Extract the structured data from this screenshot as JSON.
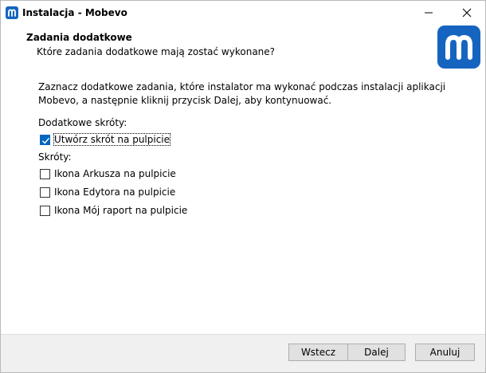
{
  "window": {
    "title": "Instalacja - Mobevo",
    "app_icon": "mobevo-app-icon",
    "minimize_icon": "minimize-icon",
    "close_icon": "close-icon"
  },
  "header": {
    "title": "Zadania dodatkowe",
    "subtitle": "Które zadania dodatkowe mają zostać wykonane?",
    "logo_icon": "mobevo-logo",
    "logo_color": "#1565c0"
  },
  "content": {
    "intro": "Zaznacz dodatkowe zadania, które instalator ma wykonać podczas instalacji aplikacji Mobevo, a następnie kliknij przycisk Dalej, aby kontynuować.",
    "group_additional_label": "Dodatkowe skróty:",
    "group_shortcuts_label": "Skróty:",
    "tasks": [
      {
        "label": "Utwórz skrót na pulpicie",
        "checked": true
      },
      {
        "label": "Ikona Arkusza na pulpicie",
        "checked": false
      },
      {
        "label": "Ikona Edytora na pulpicie",
        "checked": false
      },
      {
        "label": "Ikona Mój raport na pulpicie",
        "checked": false
      }
    ]
  },
  "buttons": {
    "back": "Wstecz",
    "next": "Dalej",
    "cancel": "Anuluj"
  }
}
